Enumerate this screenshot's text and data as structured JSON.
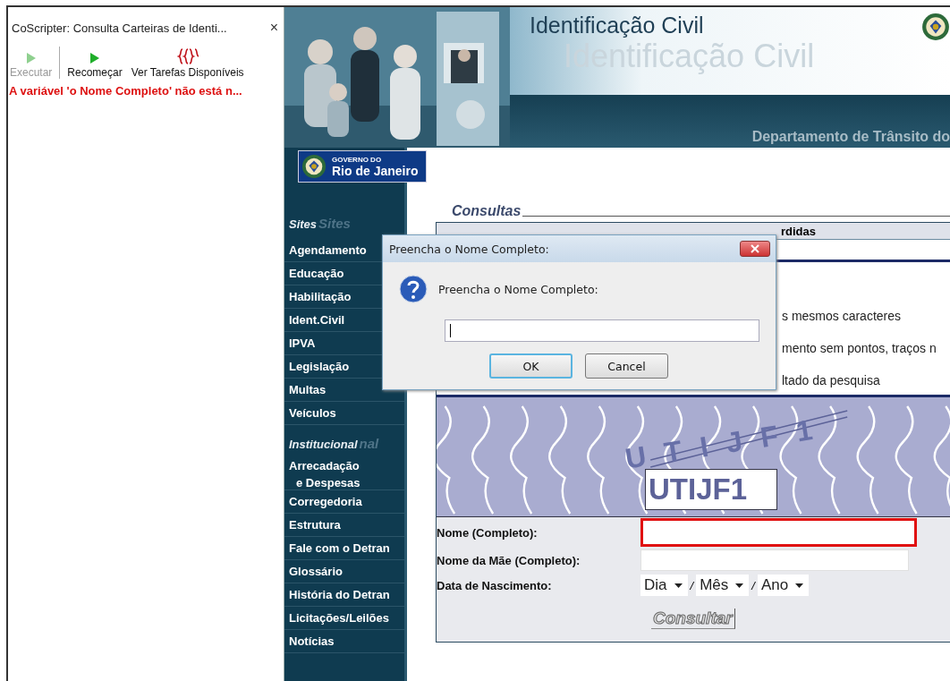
{
  "side_panel": {
    "title": "CoScripter: Consulta Carteiras de Identi...",
    "close": "×",
    "toolbar": [
      {
        "label": "Executar",
        "disabled": true
      },
      {
        "label": "Recomeçar",
        "disabled": false
      },
      {
        "label": "Ver Tarefas Disponíveis",
        "disabled": false
      }
    ],
    "error": "A variável 'o Nome Completo' não está n..."
  },
  "page": {
    "header": {
      "title": "Identificação Civil",
      "title_echo": "Identificação Civil",
      "band_text": "Departamento de Trânsito do"
    },
    "logo": {
      "small": "GOVERNO DO",
      "big": "Rio de Janeiro"
    },
    "nav": [
      {
        "kind": "section",
        "label": "Sites",
        "echo": "Sites"
      },
      {
        "kind": "link",
        "label": "Agendamento"
      },
      {
        "kind": "link",
        "label": "Educação"
      },
      {
        "kind": "link",
        "label": "Habilitação"
      },
      {
        "kind": "link",
        "label": "Ident.Civil"
      },
      {
        "kind": "link",
        "label": "IPVA"
      },
      {
        "kind": "link",
        "label": "Legislação"
      },
      {
        "kind": "link",
        "label": "Multas"
      },
      {
        "kind": "link",
        "label": "Veículos"
      },
      {
        "kind": "section",
        "label": "Institucional",
        "echo": "nal"
      },
      {
        "kind": "link",
        "label": "Arrecadação",
        "sub": "e Despesas"
      },
      {
        "kind": "link",
        "label": "Corregedoria"
      },
      {
        "kind": "link",
        "label": "Estrutura"
      },
      {
        "kind": "link",
        "label": "Fale com o Detran"
      },
      {
        "kind": "link",
        "label": "Glossário"
      },
      {
        "kind": "link",
        "label": "História do Detran"
      },
      {
        "kind": "link",
        "label": "Licitações/Leilões"
      },
      {
        "kind": "link",
        "label": "Notícias"
      }
    ],
    "content": {
      "heading": "Consultas",
      "table_header": "rdidas",
      "instructions": [
        "s mesmos caracteres",
        "mento sem pontos, traços n",
        "ltado da pesquisa"
      ],
      "captcha": {
        "distorted": "U T I J F 1",
        "code": "UTIJF1"
      },
      "fields": [
        {
          "kind": "text",
          "label": "Nome (Completo):",
          "highlighted": true
        },
        {
          "kind": "text",
          "label": "Nome da Mãe (Completo):",
          "highlighted": false
        },
        {
          "kind": "date",
          "label": "Data de Nascimento:",
          "selects": [
            "Dia",
            "Mês",
            "Ano"
          ],
          "separators": [
            "/",
            "/"
          ]
        }
      ],
      "submit": "Consultar"
    }
  },
  "dialog": {
    "title": "Preencha o Nome Completo:",
    "message": "Preencha o Nome Completo:",
    "buttons": [
      {
        "label": "OK",
        "selected": true
      },
      {
        "label": "Cancel",
        "selected": false
      }
    ]
  }
}
